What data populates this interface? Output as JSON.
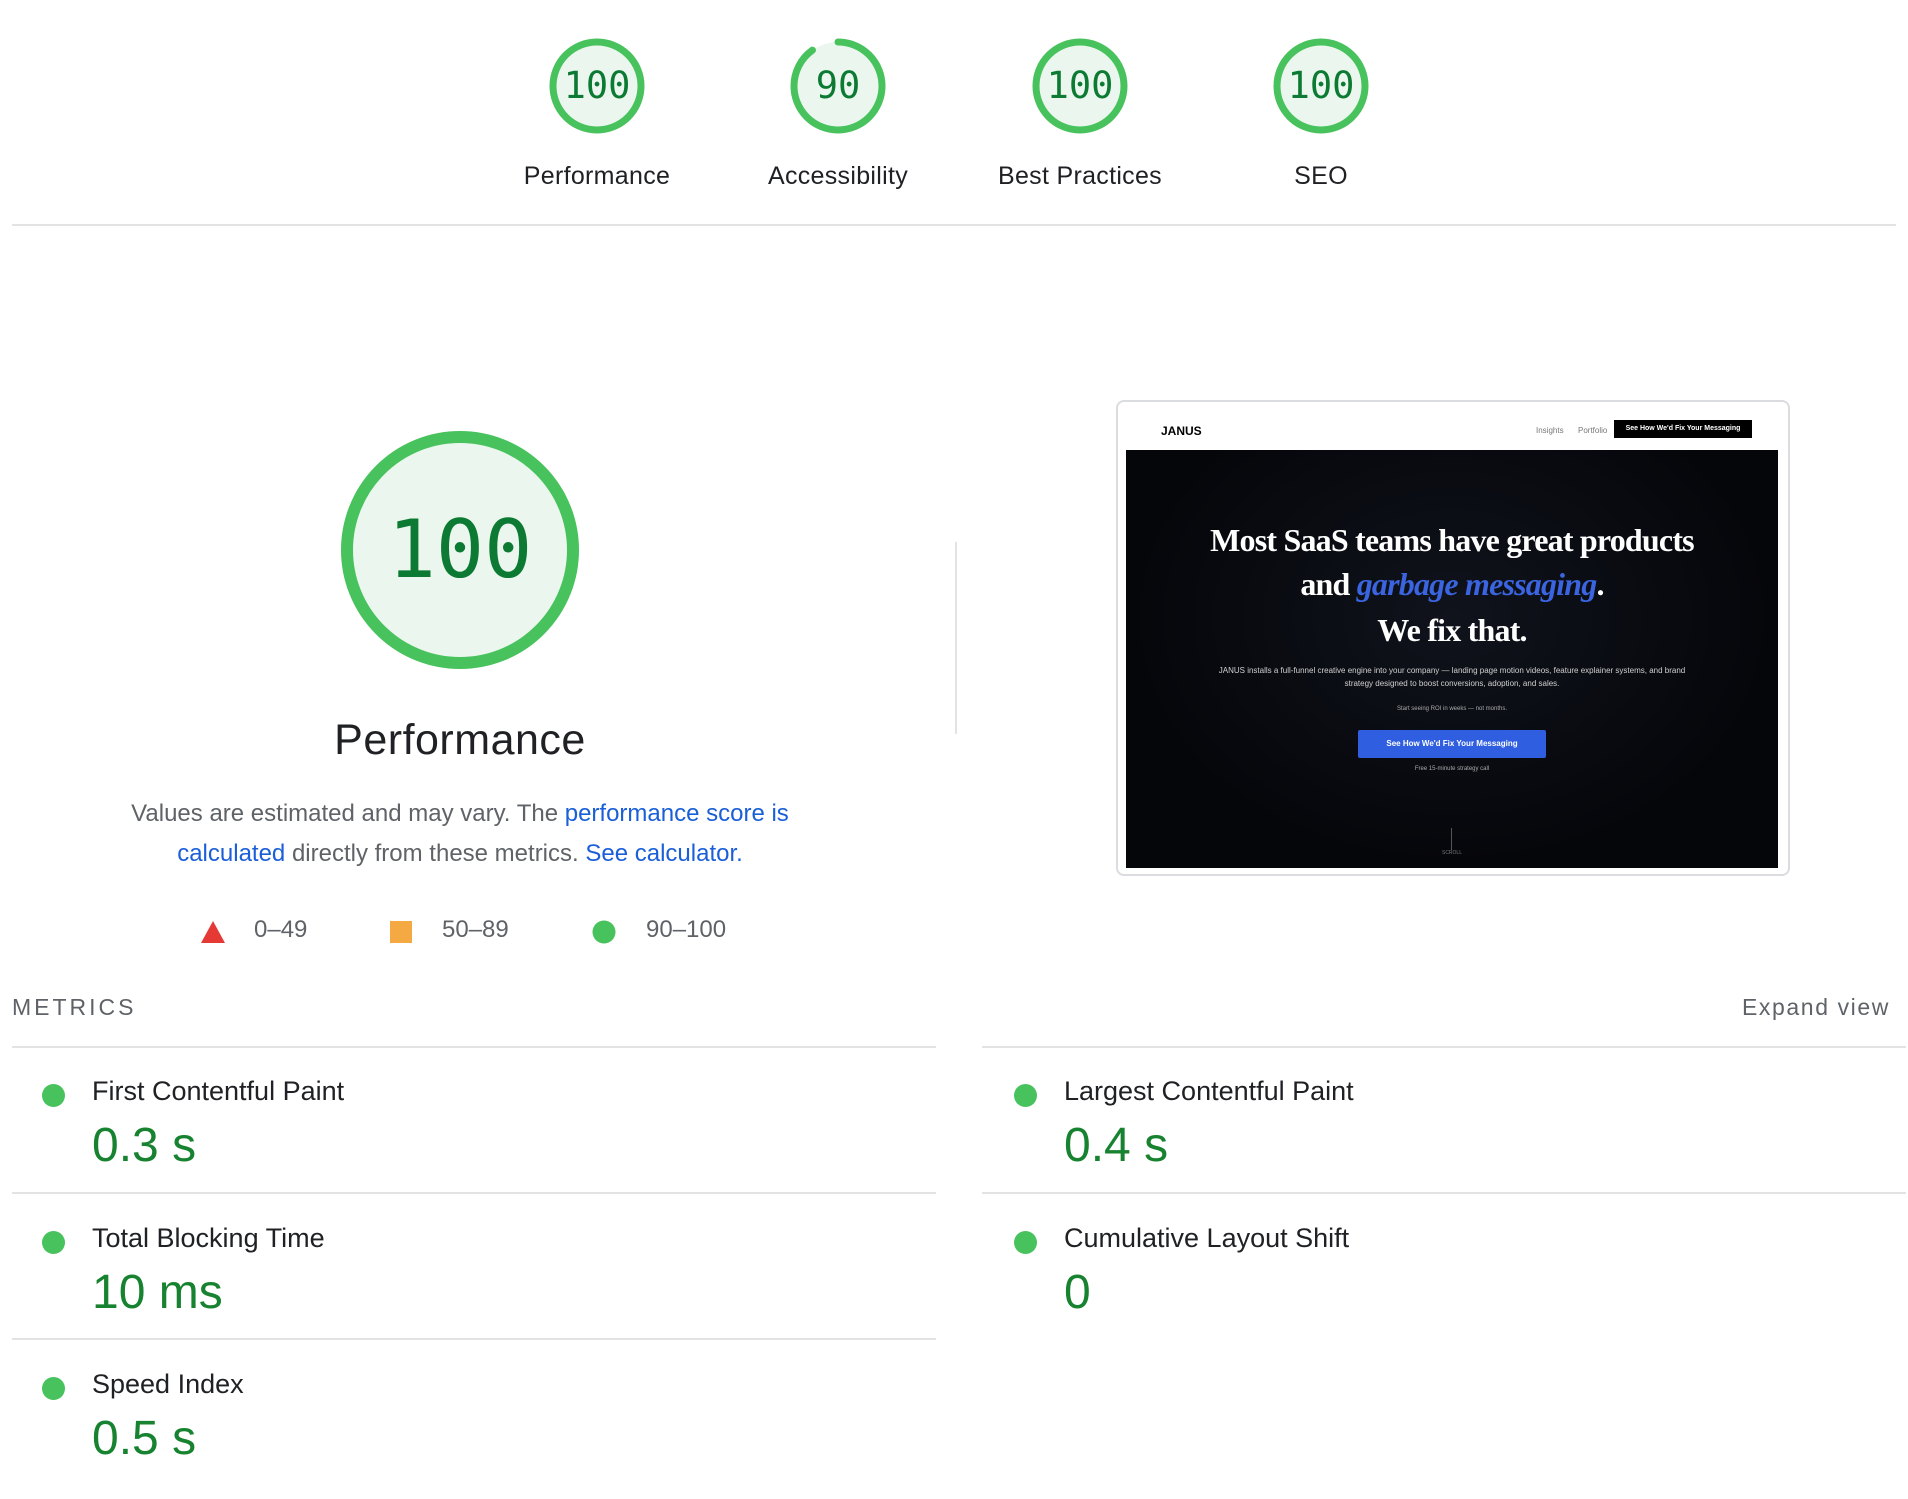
{
  "gauges": [
    {
      "label": "Performance",
      "score": "100",
      "fraction": 1.0
    },
    {
      "label": "Accessibility",
      "score": "90",
      "fraction": 0.9
    },
    {
      "label": "Best Practices",
      "score": "100",
      "fraction": 1.0
    },
    {
      "label": "SEO",
      "score": "100",
      "fraction": 1.0
    }
  ],
  "performance": {
    "score": "100",
    "fraction": 1.0,
    "title": "Performance",
    "desc_prefix": "Values are estimated and may vary. The ",
    "desc_link1": "performance score is calculated",
    "desc_middle": " directly from these metrics. ",
    "desc_link2": "See calculator."
  },
  "legend": {
    "fail": "0–49",
    "average": "50–89",
    "pass": "90–100"
  },
  "thumbnail": {
    "logo": "JANUS",
    "nav_insights": "Insights",
    "nav_portfolio": "Portfolio",
    "nav_button": "See How We'd Fix Your Messaging",
    "headline_line1": "Most SaaS teams have great products",
    "headline_line2_prefix": "and ",
    "headline_line2_em": "garbage messaging",
    "headline_line2_suffix": ".",
    "headline_line3": "We fix that.",
    "subtext": "JANUS installs a full-funnel creative engine into your company — landing page motion videos, feature explainer systems, and brand strategy designed to boost conversions, adoption, and sales.",
    "roi_text": "Start seeing ROI in weeks — not months.",
    "cta": "See How We'd Fix Your Messaging",
    "cta_note": "Free 15-minute strategy call",
    "scroll": "SCROLL"
  },
  "metrics": {
    "heading": "METRICS",
    "expand": "Expand view",
    "items": [
      {
        "name": "First Contentful Paint",
        "value": "0.3 s"
      },
      {
        "name": "Largest Contentful Paint",
        "value": "0.4 s"
      },
      {
        "name": "Total Blocking Time",
        "value": "10 ms"
      },
      {
        "name": "Cumulative Layout Shift",
        "value": "0"
      },
      {
        "name": "Speed Index",
        "value": "0.5 s"
      }
    ]
  },
  "colors": {
    "pass": "#47c25c",
    "pass_text": "#0c7a32",
    "pass_fill": "#ebf7ee",
    "average": "#f4a942",
    "fail": "#e53935",
    "link": "#1a5fd8"
  }
}
